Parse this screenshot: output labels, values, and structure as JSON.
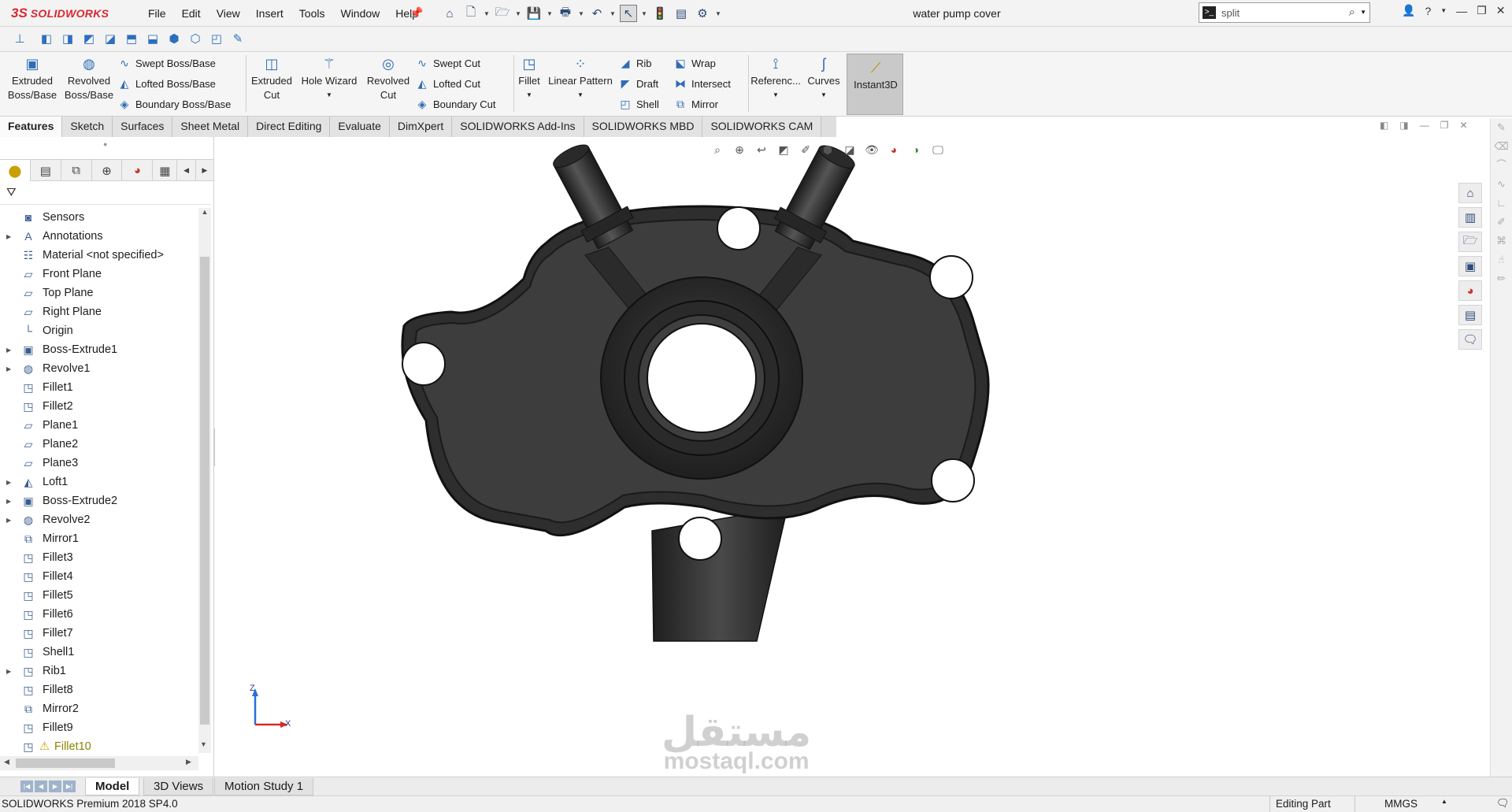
{
  "app": {
    "brand_ds": "3S",
    "brand_name": "SOLIDWORKS",
    "document_title": "water pump cover"
  },
  "menu": [
    "File",
    "Edit",
    "View",
    "Insert",
    "Tools",
    "Window",
    "Help"
  ],
  "search": {
    "value": "split"
  },
  "command_manager": {
    "extruded_boss": "Extruded\nBoss/Base",
    "revolved_boss": "Revolved\nBoss/Base",
    "swept_boss": "Swept Boss/Base",
    "lofted_boss": "Lofted Boss/Base",
    "boundary_boss": "Boundary Boss/Base",
    "extruded_cut": "Extruded\nCut",
    "hole_wizard": "Hole Wizard",
    "revolved_cut": "Revolved\nCut",
    "swept_cut": "Swept Cut",
    "lofted_cut": "Lofted Cut",
    "boundary_cut": "Boundary Cut",
    "fillet": "Fillet",
    "linear_pattern": "Linear Pattern",
    "rib": "Rib",
    "draft": "Draft",
    "shell": "Shell",
    "wrap": "Wrap",
    "intersect": "Intersect",
    "mirror": "Mirror",
    "reference": "Referenc...",
    "curves": "Curves",
    "instant3d": "Instant3D"
  },
  "tabs": [
    "Features",
    "Sketch",
    "Surfaces",
    "Sheet Metal",
    "Direct Editing",
    "Evaluate",
    "DimXpert",
    "SOLIDWORKS Add-Ins",
    "SOLIDWORKS MBD",
    "SOLIDWORKS CAM"
  ],
  "tree": [
    {
      "label": "Sensors",
      "icon": "sensor-icon",
      "glyph": "◙",
      "expandable": false
    },
    {
      "label": "Annotations",
      "icon": "annotations-icon",
      "glyph": "A",
      "expandable": true
    },
    {
      "label": "Material <not specified>",
      "icon": "material-icon",
      "glyph": "☷",
      "expandable": false
    },
    {
      "label": "Front Plane",
      "icon": "plane-icon",
      "glyph": "▱",
      "expandable": false
    },
    {
      "label": "Top Plane",
      "icon": "plane-icon",
      "glyph": "▱",
      "expandable": false
    },
    {
      "label": "Right Plane",
      "icon": "plane-icon",
      "glyph": "▱",
      "expandable": false
    },
    {
      "label": "Origin",
      "icon": "origin-icon",
      "glyph": "└",
      "expandable": false
    },
    {
      "label": "Boss-Extrude1",
      "icon": "extrude-icon",
      "glyph": "▣",
      "expandable": true
    },
    {
      "label": "Revolve1",
      "icon": "revolve-icon",
      "glyph": "◍",
      "expandable": true
    },
    {
      "label": "Fillet1",
      "icon": "fillet-icon",
      "glyph": "◳",
      "expandable": false
    },
    {
      "label": "Fillet2",
      "icon": "fillet-icon",
      "glyph": "◳",
      "expandable": false
    },
    {
      "label": "Plane1",
      "icon": "plane-icon",
      "glyph": "▱",
      "expandable": false
    },
    {
      "label": "Plane2",
      "icon": "plane-icon",
      "glyph": "▱",
      "expandable": false
    },
    {
      "label": "Plane3",
      "icon": "plane-icon",
      "glyph": "▱",
      "expandable": false
    },
    {
      "label": "Loft1",
      "icon": "loft-icon",
      "glyph": "◭",
      "expandable": true
    },
    {
      "label": "Boss-Extrude2",
      "icon": "extrude-icon",
      "glyph": "▣",
      "expandable": true
    },
    {
      "label": "Revolve2",
      "icon": "revolve-icon",
      "glyph": "◍",
      "expandable": true
    },
    {
      "label": "Mirror1",
      "icon": "mirror-icon",
      "glyph": "⧉",
      "expandable": false
    },
    {
      "label": "Fillet3",
      "icon": "fillet-icon",
      "glyph": "◳",
      "expandable": false
    },
    {
      "label": "Fillet4",
      "icon": "fillet-icon",
      "glyph": "◳",
      "expandable": false
    },
    {
      "label": "Fillet5",
      "icon": "fillet-icon",
      "glyph": "◳",
      "expandable": false
    },
    {
      "label": "Fillet6",
      "icon": "fillet-icon",
      "glyph": "◳",
      "expandable": false
    },
    {
      "label": "Fillet7",
      "icon": "fillet-icon",
      "glyph": "◳",
      "expandable": false
    },
    {
      "label": "Shell1",
      "icon": "shell-icon",
      "glyph": "◳",
      "expandable": false
    },
    {
      "label": "Rib1",
      "icon": "rib-icon",
      "glyph": "◳",
      "expandable": true
    },
    {
      "label": "Fillet8",
      "icon": "fillet-icon",
      "glyph": "◳",
      "expandable": false
    },
    {
      "label": "Mirror2",
      "icon": "mirror-icon",
      "glyph": "⧉",
      "expandable": false
    },
    {
      "label": "Fillet9",
      "icon": "fillet-icon",
      "glyph": "◳",
      "expandable": false
    },
    {
      "label": "Fillet10",
      "icon": "fillet-icon",
      "glyph": "◳",
      "expandable": false,
      "warning": true
    }
  ],
  "triad": {
    "z": "Z",
    "x": "X"
  },
  "watermark": {
    "arabic": "مستقل",
    "latin": "mostaql.com"
  },
  "bottom_tabs": [
    "Model",
    "3D Views",
    "Motion Study 1"
  ],
  "status": {
    "product": "SOLIDWORKS Premium 2018 SP4.0",
    "mode": "Editing Part",
    "units": "MMGS"
  },
  "colors": {
    "brand": "#d7282f",
    "part": "#3a3a3a",
    "accent": "#2f6db5"
  }
}
